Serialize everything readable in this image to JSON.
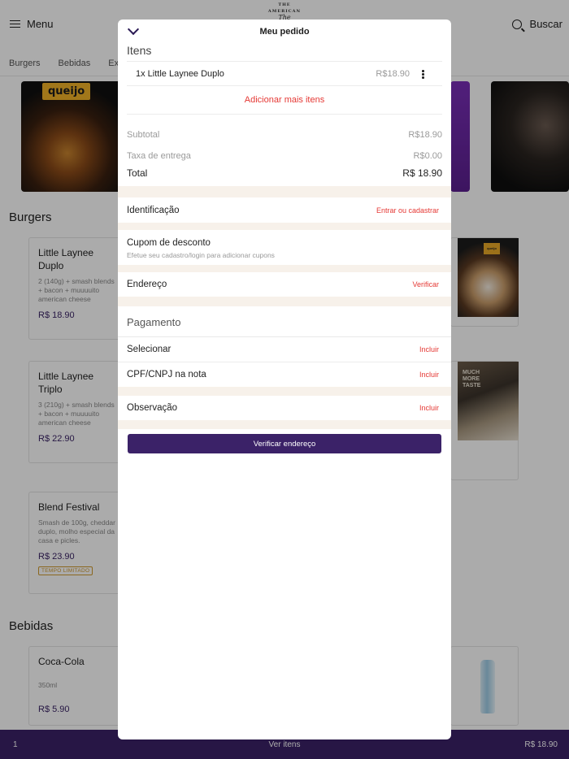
{
  "header": {
    "menu_label": "Menu",
    "search_label": "Buscar",
    "logo": {
      "top": "THE AMERICAN",
      "main": "The"
    }
  },
  "categories": [
    "Burgers",
    "Bebidas",
    "Ex"
  ],
  "banner": {
    "tag": "queijo"
  },
  "sections": {
    "burgers": "Burgers",
    "bebidas": "Bebidas"
  },
  "products": [
    {
      "name": "Little Laynee Duplo",
      "desc": "2 (140g) + smash blends + bacon + muuuuito american cheese",
      "price": "R$ 18.90"
    },
    {
      "name": "Little Laynee Triplo",
      "desc": "3 (210g) + smash blends + bacon + muuuuito american cheese",
      "price": "R$ 22.90"
    },
    {
      "name": "Blend Festival",
      "desc": "Smash de 100g, cheddar duplo, molho especial da casa e picles.",
      "price": "R$ 23.90",
      "badge": "TEMPO LIMITADO"
    },
    {
      "name": "Coca-Cola",
      "desc": "350ml",
      "price": "R$ 5.90"
    }
  ],
  "product_images": {
    "burger_tag": "queijo",
    "sandwich_text": "MUCH MORE TASTE"
  },
  "bottom_bar": {
    "count": "1",
    "label": "Ver itens",
    "total": "R$ 18.90"
  },
  "modal": {
    "title": "Meu pedido",
    "items_heading": "Itens",
    "items": [
      {
        "label": "1x Little Laynee Duplo",
        "price": "R$18.90"
      }
    ],
    "add_more": "Adicionar mais itens",
    "subtotal_label": "Subtotal",
    "subtotal_value": "R$18.90",
    "delivery_label": "Taxa de entrega",
    "delivery_value": "R$0.00",
    "total_label": "Total",
    "total_value": "R$ 18.90",
    "identification_label": "Identificação",
    "identification_action": "Entrar ou cadastrar",
    "coupon_title": "Cupom de desconto",
    "coupon_sub": "Efetue seu cadastro/login para adicionar cupons",
    "address_label": "Endereço",
    "address_action": "Verificar",
    "payment_heading": "Pagamento",
    "select_label": "Selecionar",
    "select_action": "Incluir",
    "cpf_label": "CPF/CNPJ na nota",
    "cpf_action": "Incluir",
    "notes_label": "Observação",
    "notes_action": "Incluir",
    "verify_button": "Verificar endereço"
  },
  "colors": {
    "brand": "#3b2268",
    "accent_red": "#e53935",
    "band": "#f7f1ea"
  }
}
